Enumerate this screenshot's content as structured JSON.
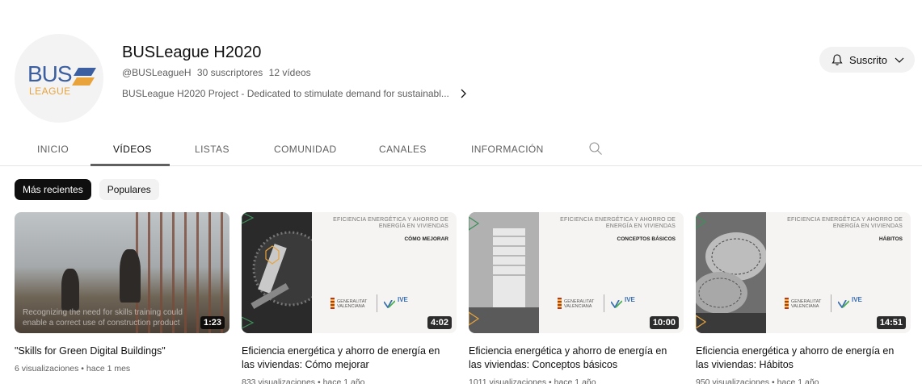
{
  "channel": {
    "logo_text_top": "BUS",
    "logo_text_bottom": "LEAGUE",
    "title": "BUSLeague H2020",
    "handle": "@BUSLeagueH",
    "subscribers": "30 suscriptores",
    "videos_count": "12 vídeos",
    "description": "BUSLeague H2020 Project - Dedicated to stimulate demand for sustainabl...",
    "subscribe_label": "Suscrito"
  },
  "tabs": [
    {
      "label": "INICIO"
    },
    {
      "label": "VÍDEOS"
    },
    {
      "label": "LISTAS"
    },
    {
      "label": "COMUNIDAD"
    },
    {
      "label": "CANALES"
    },
    {
      "label": "INFORMACIÓN"
    }
  ],
  "active_tab": "VÍDEOS",
  "filters": [
    {
      "label": "Más recientes",
      "active": true
    },
    {
      "label": "Populares",
      "active": false
    }
  ],
  "videos": [
    {
      "title": "\"Skills for Green Digital Buildings\"",
      "meta": "6 visualizaciones • hace 1 mes",
      "duration": "1:23",
      "thumb_caption": "Recognizing the need for skills training could enable a correct use of construction product"
    },
    {
      "title": "Eficiencia energética y ahorro de energía en las viviendas: Cómo mejorar",
      "meta": "833 visualizaciones • hace 1 año",
      "duration": "4:02",
      "thumb_header": "EFICIENCIA ENERGÉTICA Y AHORRO DE ENERGÍA EN VIVIENDAS",
      "thumb_sub": "CÓMO MEJORAR"
    },
    {
      "title": "Eficiencia energética y ahorro de energía en las viviendas: Conceptos básicos",
      "meta": "1011 visualizaciones • hace 1 año",
      "duration": "10:00",
      "thumb_header": "EFICIENCIA ENERGÉTICA Y AHORRO DE ENERGÍA EN VIVIENDAS",
      "thumb_sub": "CONCEPTOS BÁSICOS"
    },
    {
      "title": "Eficiencia energética y ahorro de energía en las viviendas: Hábitos",
      "meta": "950 visualizaciones • hace 1 año",
      "duration": "14:51",
      "thumb_header": "EFICIENCIA ENERGÉTICA Y AHORRO DE ENERGÍA EN VIVIENDAS",
      "thumb_sub": "HÁBITOS"
    }
  ],
  "thumb_logos": {
    "gv_line1": "GENERALITAT",
    "gv_line2": "VALENCIANA",
    "ive": "IVE"
  },
  "colors": {
    "active_chip_bg": "#0f0f0f",
    "logo_blue": "#3b5fa0",
    "logo_orange": "#e8a33c",
    "accent_green": "#3f8f5a"
  }
}
